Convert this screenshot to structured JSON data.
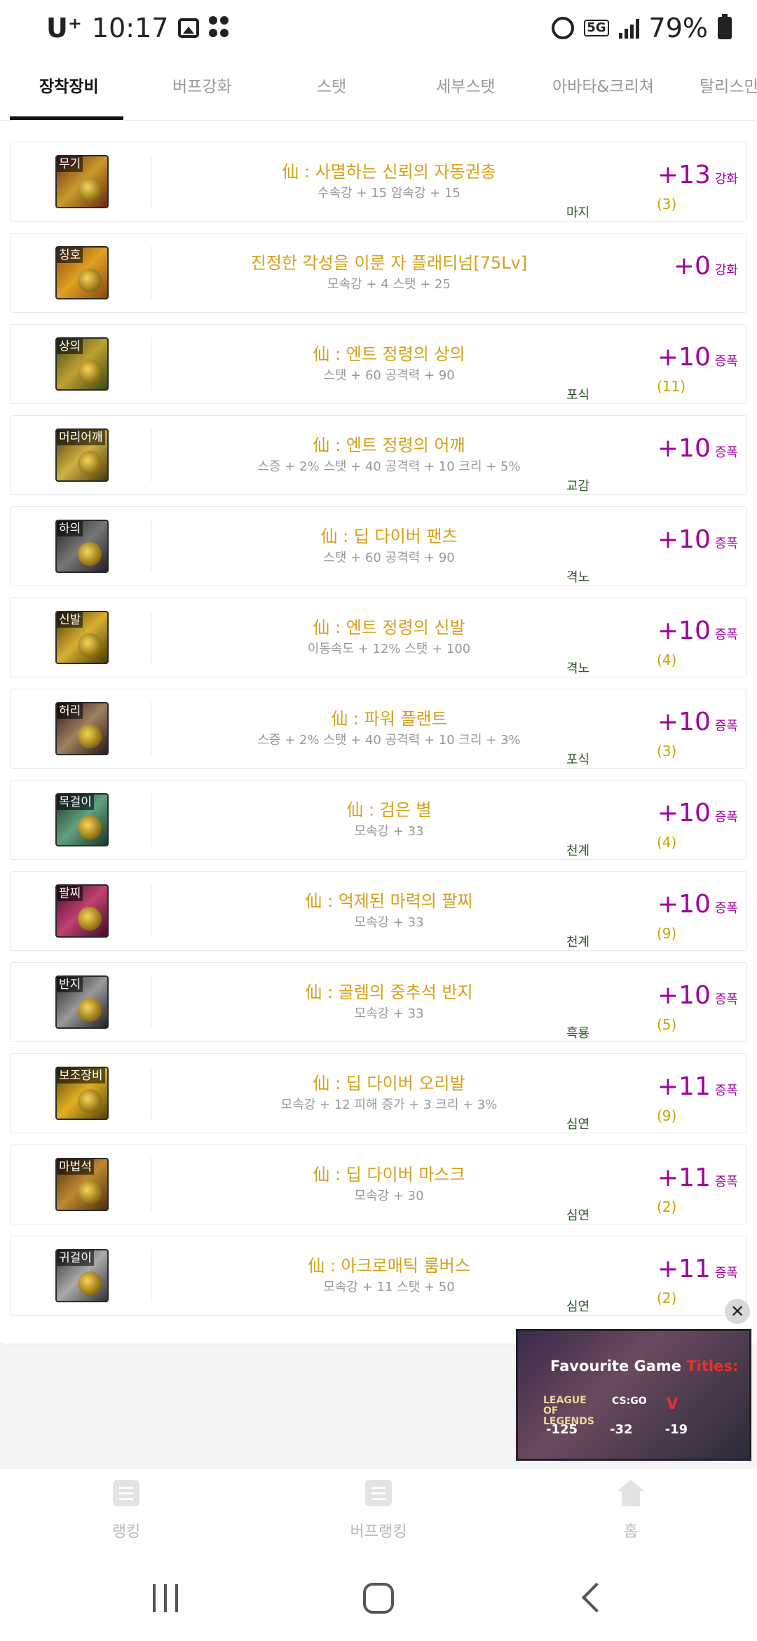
{
  "status_bar": {
    "carrier": "U⁺",
    "time": "10:17",
    "network": "5G",
    "battery": "79%"
  },
  "tabs": [
    {
      "label": "장착장비",
      "active": true
    },
    {
      "label": "버프강화",
      "active": false
    },
    {
      "label": "스탯",
      "active": false
    },
    {
      "label": "세부스탯",
      "active": false
    },
    {
      "label": "아바타&크리쳐",
      "active": false
    },
    {
      "label": "탈리스만",
      "active": false
    }
  ],
  "items": [
    {
      "slot": "무기",
      "name": "仙 : 사멸하는 신뢰의 자동권총",
      "stats": "수속강 + 15 암속강 + 15",
      "set": "마지",
      "enh": "+13",
      "enh_type": "강화",
      "count": "(3)"
    },
    {
      "slot": "칭호",
      "name": "진정한 각성을 이룬 자 플래티넘[75Lv]",
      "stats": "모속강 + 4 스탯 + 25",
      "set": "",
      "enh": "+0",
      "enh_type": "강화",
      "count": ""
    },
    {
      "slot": "상의",
      "name": "仙 : 엔트 정령의 상의",
      "stats": "스탯 + 60 공격력 + 90",
      "set": "포식",
      "enh": "+10",
      "enh_type": "증폭",
      "count": "(11)"
    },
    {
      "slot": "머리어깨",
      "name": "仙 : 엔트 정령의 어깨",
      "stats": "스증 + 2% 스탯 + 40 공격력 + 10 크리 + 5%",
      "set": "교감",
      "enh": "+10",
      "enh_type": "증폭",
      "count": ""
    },
    {
      "slot": "하의",
      "name": "仙 : 딥 다이버 팬츠",
      "stats": "스탯 + 60 공격력 + 90",
      "set": "격노",
      "enh": "+10",
      "enh_type": "증폭",
      "count": ""
    },
    {
      "slot": "신발",
      "name": "仙 : 엔트 정령의 신발",
      "stats": "이동속도 + 12% 스탯 + 100",
      "set": "격노",
      "enh": "+10",
      "enh_type": "증폭",
      "count": "(4)"
    },
    {
      "slot": "허리",
      "name": "仙 : 파워 플랜트",
      "stats": "스증 + 2% 스탯 + 40 공격력 + 10 크리 + 3%",
      "set": "포식",
      "enh": "+10",
      "enh_type": "증폭",
      "count": "(3)"
    },
    {
      "slot": "목걸이",
      "name": "仙 : 검은 별",
      "stats": "모속강 + 33",
      "set": "천계",
      "enh": "+10",
      "enh_type": "증폭",
      "count": "(4)"
    },
    {
      "slot": "팔찌",
      "name": "仙 : 억제된 마력의 팔찌",
      "stats": "모속강 + 33",
      "set": "천계",
      "enh": "+10",
      "enh_type": "증폭",
      "count": "(9)"
    },
    {
      "slot": "반지",
      "name": "仙 : 골렘의 중추석 반지",
      "stats": "모속강 + 33",
      "set": "흑룡",
      "enh": "+10",
      "enh_type": "증폭",
      "count": "(5)"
    },
    {
      "slot": "보조장비",
      "name": "仙 : 딥 다이버 오리발",
      "stats": "모속강 + 12 피해 증가 + 3 크리 + 3%",
      "set": "심연",
      "enh": "+11",
      "enh_type": "증폭",
      "count": "(9)"
    },
    {
      "slot": "마법석",
      "name": "仙 : 딥 다이버 마스크",
      "stats": "모속강 + 30",
      "set": "심연",
      "enh": "+11",
      "enh_type": "증폭",
      "count": "(2)"
    },
    {
      "slot": "귀걸이",
      "name": "仙 : 아크로매틱 룸버스",
      "stats": "모속강 + 11 스탯 + 50",
      "set": "심연",
      "enh": "+11",
      "enh_type": "증폭",
      "count": "(2)"
    }
  ],
  "ad": {
    "close": "✕",
    "title_white": "Favourite Game ",
    "title_red": "Titles:",
    "logos": [
      "LEAGUE OF LEGENDS",
      "CS:GO",
      "V"
    ],
    "nums": [
      "-125",
      "-32",
      "-19"
    ]
  },
  "bottom_nav": [
    {
      "label": "랭킹",
      "icon": "list-icon"
    },
    {
      "label": "버프랭킹",
      "icon": "list-icon"
    },
    {
      "label": "홈",
      "icon": "home-icon"
    }
  ],
  "colors": {
    "item_name": "#d4a017",
    "enhance": "#a0009e",
    "set_name": "#2d5a27",
    "count": "#caa200"
  }
}
